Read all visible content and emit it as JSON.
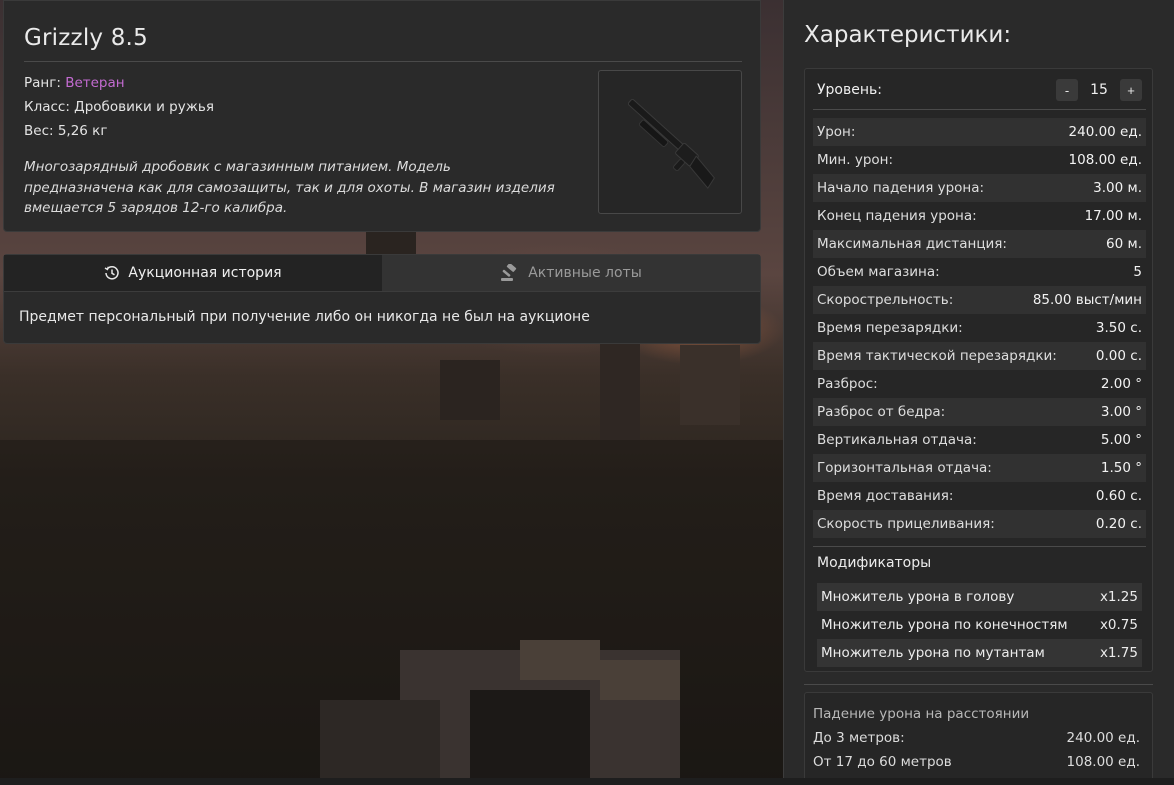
{
  "item": {
    "name": "Grizzly 8.5",
    "rank_label": "Ранг: ",
    "rank_value": "Ветеран",
    "rank_color": "#c36bd1",
    "class_line": "Класс: Дробовики и ружья",
    "weight_line": "Вес: 5,26 кг",
    "description": "Многозарядный дробовик с магазинным питанием. Модель предназначена как для самозащиты, так и для охоты. В магазин изделия вмещается 5 зарядов 12-го калибра."
  },
  "history": {
    "tabs": [
      {
        "label": "Аукционная история",
        "icon": "history-icon",
        "active": true
      },
      {
        "label": "Активные лоты",
        "icon": "gavel-icon",
        "active": false
      }
    ],
    "message": "Предмет персональный при получение либо он никогда не был на аукционе"
  },
  "stats": {
    "title": "Характеристики:",
    "level_label": "Уровень:",
    "level_value": "15",
    "minus": "-",
    "plus": "+",
    "rows": [
      {
        "label": "Урон:",
        "value": "240.00 ед."
      },
      {
        "label": "Мин. урон:",
        "value": "108.00 ед."
      },
      {
        "label": "Начало падения урона:",
        "value": "3.00 м."
      },
      {
        "label": "Конец падения урона:",
        "value": "17.00 м."
      },
      {
        "label": "Максимальная дистанция:",
        "value": "60 м."
      },
      {
        "label": "Объем магазина:",
        "value": "5"
      },
      {
        "label": "Скорострельность:",
        "value": "85.00 выст/мин"
      },
      {
        "label": "Время перезарядки:",
        "value": "3.50 с."
      },
      {
        "label": "Время тактической перезарядки:",
        "value": "0.00 с."
      },
      {
        "label": "Разброс:",
        "value": "2.00 °"
      },
      {
        "label": "Разброс от бедра:",
        "value": "3.00 °"
      },
      {
        "label": "Вертикальная отдача:",
        "value": "5.00 °"
      },
      {
        "label": "Горизонтальная отдача:",
        "value": "1.50 °"
      },
      {
        "label": "Время доставания:",
        "value": "0.60 с."
      },
      {
        "label": "Скорость прицеливания:",
        "value": "0.20 с."
      }
    ],
    "modifiers_title": "Модификаторы",
    "modifiers": [
      {
        "label": "Множитель урона в голову",
        "value": "x1.25"
      },
      {
        "label": "Множитель урона по конечностям",
        "value": "x0.75"
      },
      {
        "label": "Множитель урона по мутантам",
        "value": "x1.75"
      }
    ]
  },
  "falloff": {
    "title": "Падение урона на расстоянии",
    "rows": [
      {
        "label": "До 3 метров:",
        "value": "240.00 ед."
      },
      {
        "label": "От 17 до 60 метров",
        "value": "108.00 ед."
      }
    ]
  }
}
